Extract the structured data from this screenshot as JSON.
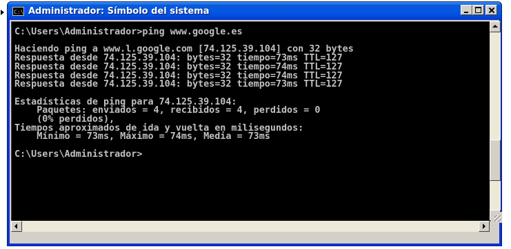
{
  "window": {
    "title": "Administrador: Símbolo del sistema",
    "icon": "console-icon",
    "icon_glyph": "C:\\",
    "buttons": {
      "minimize": "minimize-icon",
      "maximize": "maximize-icon",
      "close": "close-icon"
    }
  },
  "console": {
    "lines": [
      "C:\\Users\\Administrador>ping www.google.es",
      "",
      "Haciendo ping a www.l.google.com [74.125.39.104] con 32 bytes",
      "Respuesta desde 74.125.39.104: bytes=32 tiempo=73ms TTL=127",
      "Respuesta desde 74.125.39.104: bytes=32 tiempo=74ms TTL=127",
      "Respuesta desde 74.125.39.104: bytes=32 tiempo=74ms TTL=127",
      "Respuesta desde 74.125.39.104: bytes=32 tiempo=73ms TTL=127",
      "",
      "Estadísticas de ping para 74.125.39.104:",
      "    Paquetes: enviados = 4, recibidos = 4, perdidos = 0",
      "    (0% perdidos),",
      "Tiempos aproximados de ida y vuelta en milisegundos:",
      "    Mínimo = 73ms, Máximo = 74ms, Media = 73ms",
      "",
      "C:\\Users\\Administrador>"
    ],
    "colors": {
      "background": "#000000",
      "foreground": "#c0c0c0"
    }
  }
}
